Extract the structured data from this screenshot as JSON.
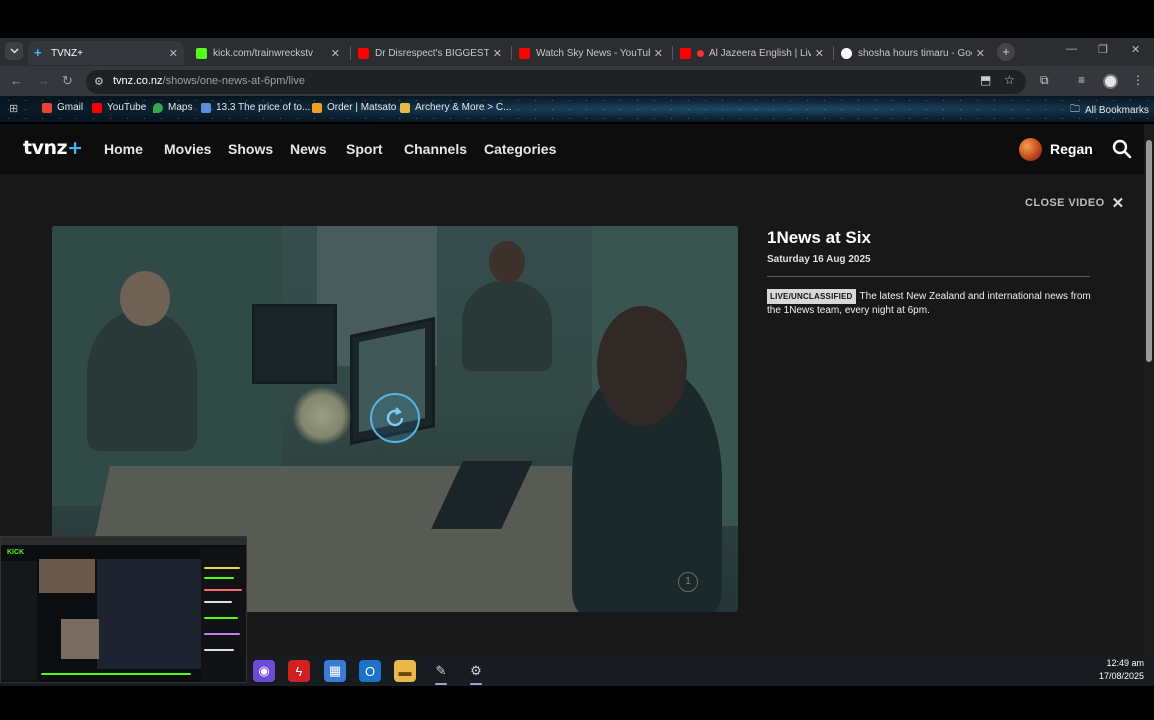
{
  "browser": {
    "tabs": [
      {
        "title": "TVNZ+",
        "active": true,
        "favicon_color": "#3db8ff"
      },
      {
        "title": "kick.com/trainwreckstv",
        "active": false,
        "favicon_color": "#53fc18"
      },
      {
        "title": "Dr Disrespect's BIGGEST A",
        "active": false,
        "favicon_color": "#ff0000"
      },
      {
        "title": "Watch Sky News - YouTube",
        "active": false,
        "favicon_color": "#ff0000"
      },
      {
        "title": "Al Jazeera English | Live",
        "active": false,
        "favicon_color": "#ff0000"
      },
      {
        "title": "shosha hours timaru - Goog",
        "active": false,
        "favicon_color": "#4285f4"
      }
    ],
    "url_host": "tvnz.co.nz",
    "url_path": "/shows/one-news-at-6pm/live",
    "bookmarks": [
      {
        "label": "Gmail",
        "color": "#ea4335"
      },
      {
        "label": "YouTube",
        "color": "#ff0000"
      },
      {
        "label": "Maps",
        "color": "#34a853"
      },
      {
        "label": "13.3 The price of to...",
        "color": "#5b8fd6"
      },
      {
        "label": "Order | Matsato",
        "color": "#f0a020"
      },
      {
        "label": "Archery & More > C...",
        "color": "#e8b84a"
      }
    ],
    "all_bookmarks": "All Bookmarks"
  },
  "site": {
    "logo_text": "tvnz",
    "logo_plus": "+",
    "nav": [
      "Home",
      "Movies",
      "Shows",
      "News",
      "Sport",
      "Channels",
      "Categories"
    ],
    "user_name": "Regan",
    "close_video": "CLOSE VIDEO"
  },
  "show": {
    "title": "1News at Six",
    "date": "Saturday 16 Aug 2025",
    "rating_badge": "LIVE/UNCLASSIFIED",
    "description": "The latest New Zealand and international news from the 1News team, every night at 6pm.",
    "watermark": "1"
  },
  "taskbar": {
    "time": "12:49 am",
    "date": "17/08/2025",
    "apps": [
      {
        "icon": "purple-app-icon",
        "color": "#6b4bd8"
      },
      {
        "icon": "lightning-app-icon",
        "color": "#d02020"
      },
      {
        "icon": "store-icon",
        "color": "#3a7bd5"
      },
      {
        "icon": "outlook-icon",
        "color": "#1a73c8"
      },
      {
        "icon": "folder-icon",
        "color": "#e8b84a"
      },
      {
        "icon": "tool-app-icon",
        "color": "#888888"
      },
      {
        "icon": "steam-icon",
        "color": "#1b2838"
      }
    ]
  },
  "mini_window": {
    "brand": "KICK"
  }
}
